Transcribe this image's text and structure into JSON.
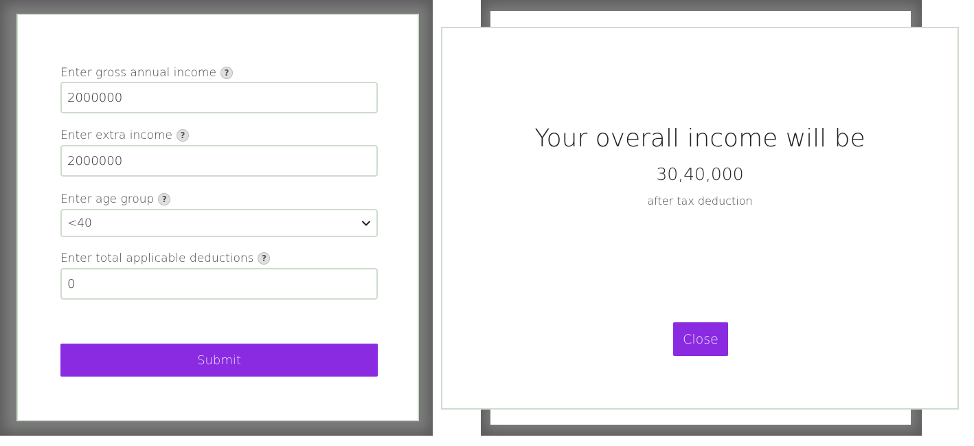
{
  "form": {
    "gross_income": {
      "label": "Enter gross annual income",
      "value": "2000000",
      "help_icon": "question-circle-icon"
    },
    "extra_income": {
      "label": "Enter extra income",
      "value": "2000000",
      "help_icon": "question-circle-icon"
    },
    "age_group": {
      "label": "Enter age group",
      "selected": "<40",
      "help_icon": "question-circle-icon"
    },
    "deductions": {
      "label": "Enter total applicable deductions",
      "value": "0",
      "help_icon": "question-circle-icon"
    },
    "help_glyph": "?",
    "submit_label": "Submit"
  },
  "result": {
    "title": "Your overall income will be",
    "amount": "30,40,000",
    "subtitle": "after tax deduction",
    "close_label": "Close"
  },
  "colors": {
    "accent": "#8a2be2",
    "border": "#cfdccd",
    "backdrop": "#7d7d7d"
  }
}
